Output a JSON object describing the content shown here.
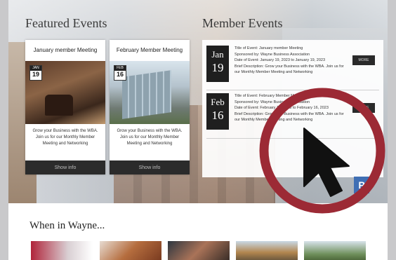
{
  "featured": {
    "heading": "Featured Events",
    "cards": [
      {
        "title": "January member Meeting",
        "cal_month": "JAN",
        "cal_day": "19",
        "description": "Grow your Business with the WBA. Join us for our Monthly Member Meeting and Networking",
        "button": "Show info"
      },
      {
        "title": "February Member Meeting",
        "cal_month": "FEB",
        "cal_day": "16",
        "description": "Grow your Business with the WBA. Join us for our Monthly Member Meeting and Networking",
        "button": "Show info"
      }
    ]
  },
  "member": {
    "heading": "Member Events",
    "events": [
      {
        "month": "Jan",
        "day": "19",
        "title_line": "Title of Event: January member Meeting",
        "sponsor_line": "Sponsored by: Wayne Business Association",
        "date_line": "Date of Event: January 19, 2023 to January 19, 2023",
        "desc_line": "Brief Description: Grow your Business with the WBA. Join us for our Monthly Member Meeting and Networking",
        "button": "MORE"
      },
      {
        "month": "Feb",
        "day": "16",
        "title_line": "Title of Event: February Member Meeting",
        "sponsor_line": "Sponsored by: Wayne Business Association",
        "date_line": "Date of Event: February 16, 2023 to February 16, 2023",
        "desc_line": "Brief Description: Grow your Business with the WBA. Join us for our Monthly Member Meeting and Networking",
        "button": "MORE"
      }
    ]
  },
  "parking_sign": "P",
  "wayne": {
    "heading": "When in Wayne..."
  },
  "colors": {
    "accent_circle": "#9c2a35",
    "cursor": "#111111",
    "dark_button": "#2b2b2b"
  },
  "icons": {
    "pointer": "arrow-cursor-icon",
    "highlight": "highlight-circle-icon"
  }
}
